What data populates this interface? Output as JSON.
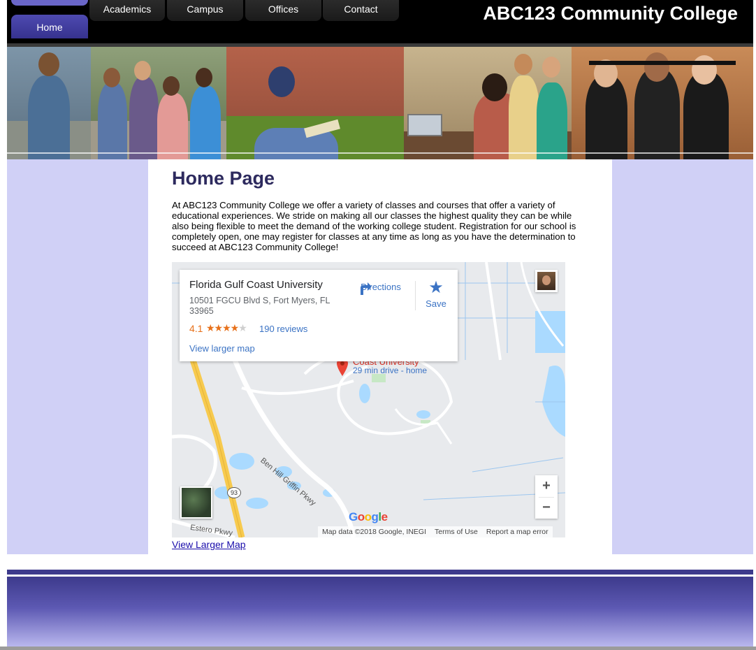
{
  "header": {
    "site_title": "ABC123 Community College",
    "nav": {
      "home": "Home",
      "academics": "Academics",
      "campus": "Campus",
      "offices": "Offices",
      "contact": "Contact"
    }
  },
  "main": {
    "title": "Home Page",
    "intro": "At ABC123 Community College we offer a variety of classes and courses that offer a variety of educational experiences. We stride on making all our classes the highest quality they can be while also being flexible to meet the demand of the working college student. Registration for our school is completely open, one may register for classes at any time as long as you have the determination to succeed at ABC123 Community College!",
    "view_larger_link": "View Larger Map"
  },
  "map": {
    "place_name": "Florida Gulf Coast University",
    "address": "10501 FGCU Blvd S, Fort Myers, FL 33965",
    "rating": "4.1",
    "rating_value": 4.1,
    "stars_filled": "★★★★",
    "stars_empty": "★",
    "reviews": "190 reviews",
    "view_larger_map": "View larger map",
    "directions_label": "Directions",
    "save_label": "Save",
    "pin_label_line1": "Coast University",
    "pin_label_line2": "29 min drive - home",
    "road_label_1": "Ben Hill Griffin Pkwy",
    "road_label_2": "Estero Pkwy",
    "route_number": "93",
    "zoom_in": "+",
    "zoom_out": "−",
    "google_logo": [
      "G",
      "o",
      "o",
      "g",
      "l",
      "e"
    ],
    "attribution": {
      "map_data": "Map data ©2018 Google, INEGI",
      "terms": "Terms of Use",
      "report": "Report a map error"
    },
    "icons": {
      "directions": "directions-icon",
      "save": "star-icon",
      "pin": "map-pin-icon",
      "satellite": "satellite-toggle",
      "avatar": "user-avatar"
    }
  },
  "colors": {
    "header_bg": "#000000",
    "nav_active": "#4e4ab0",
    "side_column": "#d0d0f6",
    "title_text": "#2d2a5e",
    "footer_top": "#3d3a8c",
    "footer_bottom": "#b9b7ee",
    "map_link": "#3b73c4",
    "rating": "#e7711b"
  }
}
